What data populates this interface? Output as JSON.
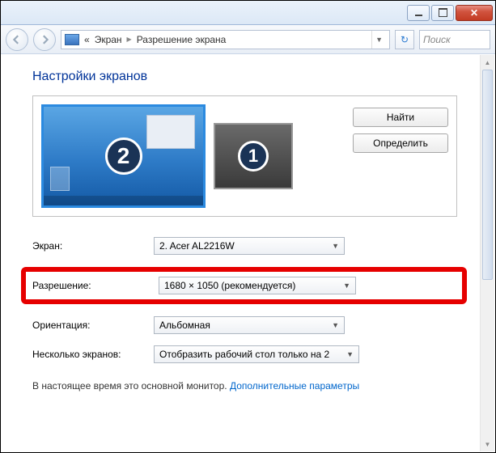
{
  "breadcrumb": {
    "start": "«",
    "item1": "Экран",
    "item2": "Разрешение экрана"
  },
  "search": {
    "placeholder": "Поиск"
  },
  "title": "Настройки экранов",
  "monitors": {
    "active": "2",
    "other": "1"
  },
  "buttons": {
    "find": "Найти",
    "identify": "Определить"
  },
  "fields": {
    "display_label": "Экран:",
    "display_value": "2. Acer AL2216W",
    "resolution_label": "Разрешение:",
    "resolution_value": "1680 × 1050 (рекомендуется)",
    "orientation_label": "Ориентация:",
    "orientation_value": "Альбомная",
    "multi_label": "Несколько экранов:",
    "multi_value": "Отобразить рабочий стол только на 2"
  },
  "note_text": "В настоящее время это основной монитор.",
  "note_link": "Дополнительные параметры"
}
